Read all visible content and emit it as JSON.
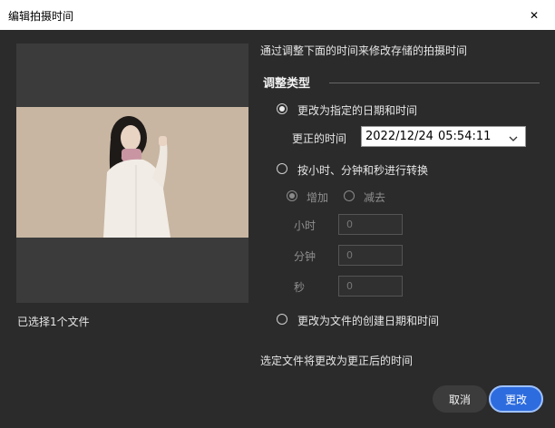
{
  "window": {
    "title": "编辑拍摄时间",
    "close_glyph": "✕"
  },
  "preview": {
    "selected_count": "已选择1个文件"
  },
  "description": "通过调整下面的时间来修改存储的拍摄时间",
  "section_title": "调整类型",
  "options": {
    "change_to_date": {
      "label": "更改为指定的日期和时间",
      "checked": true
    },
    "corrected_time_label": "更正的时间",
    "datetime": {
      "date": "2022/12/24",
      "time": "05:54:11",
      "chevron": "⌵"
    },
    "shift_by": {
      "label": "按小时、分钟和秒进行转换",
      "checked": false
    },
    "add": {
      "label": "增加",
      "checked": true
    },
    "subtract": {
      "label": "减去",
      "checked": false
    },
    "hours": {
      "label": "小时",
      "value": "0"
    },
    "minutes": {
      "label": "分钟",
      "value": "0"
    },
    "seconds": {
      "label": "秒",
      "value": "0"
    },
    "change_to_created": {
      "label": "更改为文件的创建日期和时间",
      "checked": false
    }
  },
  "footer_note": "选定文件将更改为更正后的时间",
  "buttons": {
    "cancel": "取消",
    "ok": "更改"
  },
  "colors": {
    "background": "#2b2b2b",
    "accent": "#2d6cdf"
  }
}
